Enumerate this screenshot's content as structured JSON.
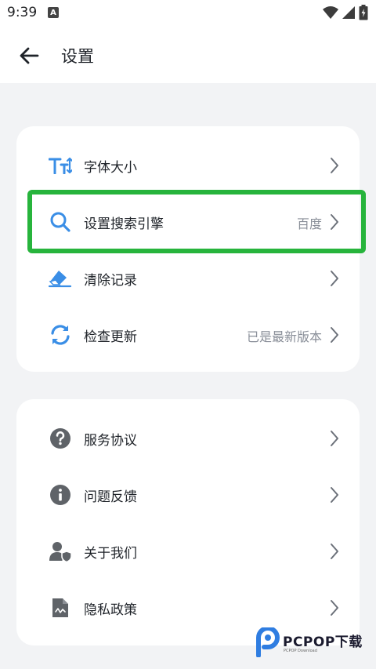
{
  "status_bar": {
    "time": "9:39",
    "notification_letter": "A"
  },
  "header": {
    "title": "设置"
  },
  "card1": {
    "items": [
      {
        "label": "字体大小",
        "value": ""
      },
      {
        "label": "设置搜索引擎",
        "value": "百度"
      },
      {
        "label": "清除记录",
        "value": ""
      },
      {
        "label": "检查更新",
        "value": "已是最新版本"
      }
    ]
  },
  "card2": {
    "items": [
      {
        "label": "服务协议",
        "value": ""
      },
      {
        "label": "问题反馈",
        "value": ""
      },
      {
        "label": "关于我们",
        "value": ""
      },
      {
        "label": "隐私政策",
        "value": ""
      }
    ]
  },
  "watermark": {
    "text": "PCPOP下载",
    "subtext": "PCPOP Download"
  },
  "colors": {
    "accent_blue": "#3a8ee6",
    "icon_gray": "#5f6368",
    "highlight_green": "#27b43c",
    "background": "#f2f3f5"
  },
  "icons": {
    "font_size": "text-size-icon",
    "search": "search-icon",
    "clear": "eraser-icon",
    "update": "refresh-icon",
    "service": "question-icon",
    "feedback": "info-icon",
    "about": "user-shield-icon",
    "privacy": "document-icon"
  }
}
